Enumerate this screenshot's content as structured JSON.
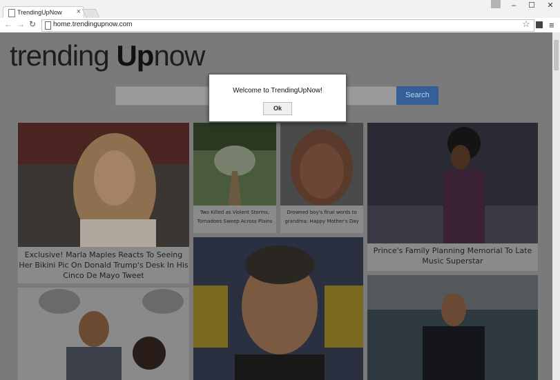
{
  "browser": {
    "tab_title": "TrendingUpNow",
    "tab_close": "×",
    "url": "home.trendingupnow.com",
    "window_buttons": [
      "–",
      "☐",
      "✕"
    ],
    "nav": {
      "back": "←",
      "forward": "→",
      "reload": "↻"
    },
    "star": "☆",
    "menu": "≡"
  },
  "site": {
    "logo_left": "trending ",
    "logo_up": "Up",
    "logo_right": "now",
    "search_button": "Search"
  },
  "cards": [
    {
      "caption": "Exclusive! Marla Maples Reacts To Seeing Her Bikini Pic On Donald Trump's Desk In His Cinco De Mayo Tweet"
    },
    {
      "caption": "Two Killed as Violent Storms, Tornadoes Sweep Across Plains"
    },
    {
      "caption": "Drowned boy's final words to grandma: Happy Mother's Day"
    },
    {
      "caption": "Prince's Family Planning Memorial To Late Music Superstar"
    },
    {
      "caption": ""
    },
    {
      "caption": ""
    },
    {
      "caption": ""
    }
  ],
  "dialog": {
    "message": "Welcome to TrendingUpNow!",
    "ok_label": "Ok"
  }
}
